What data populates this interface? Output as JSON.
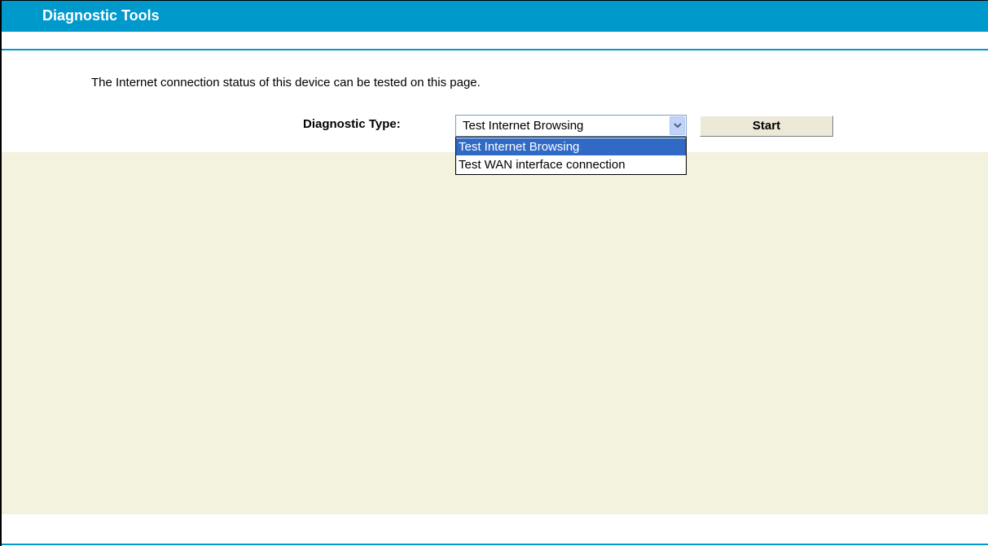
{
  "header": {
    "title": "Diagnostic Tools"
  },
  "main": {
    "description": "The Internet connection status of this device can be tested on this page.",
    "diagnostic_type_label": "Diagnostic Type:",
    "diagnostic_type_value": "Test Internet Browsing",
    "diagnostic_type_options": [
      "Test Internet Browsing",
      "Test WAN interface connection"
    ],
    "start_label": "Start"
  },
  "colors": {
    "header_bg": "#0099cc",
    "panel_bg": "#f3f2de",
    "selection_bg": "#316ac5"
  },
  "icons": {
    "dropdown_arrow": "chevron-down-icon"
  }
}
